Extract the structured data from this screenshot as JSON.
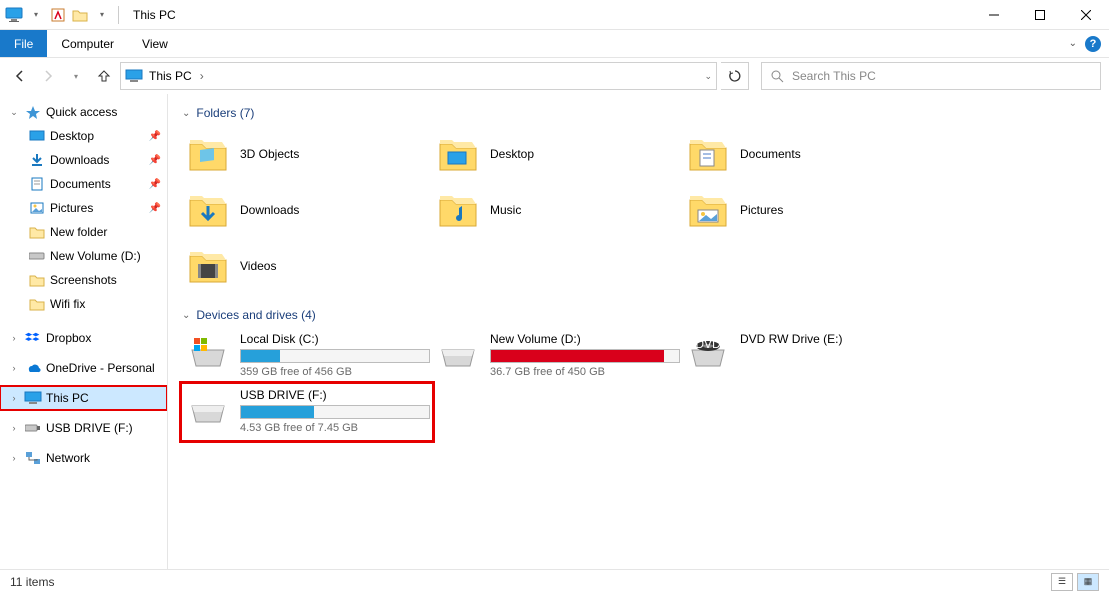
{
  "title": "This PC",
  "ribbon": {
    "file": "File",
    "computer": "Computer",
    "view": "View"
  },
  "breadcrumb": {
    "root": "This PC"
  },
  "search_placeholder": "Search This PC",
  "sidebar": {
    "quick_access": "Quick access",
    "qa_children": [
      {
        "label": "Desktop",
        "pin": true
      },
      {
        "label": "Downloads",
        "pin": true
      },
      {
        "label": "Documents",
        "pin": true
      },
      {
        "label": "Pictures",
        "pin": true
      },
      {
        "label": "New folder",
        "pin": false
      },
      {
        "label": "New Volume (D:)",
        "pin": false
      },
      {
        "label": "Screenshots",
        "pin": false
      },
      {
        "label": "Wifi fix",
        "pin": false
      }
    ],
    "dropbox": "Dropbox",
    "onedrive": "OneDrive - Personal",
    "this_pc": "This PC",
    "usb": "USB DRIVE (F:)",
    "network": "Network"
  },
  "groups": {
    "folders": {
      "title": "Folders (7)",
      "items": [
        "3D Objects",
        "Desktop",
        "Documents",
        "Downloads",
        "Music",
        "Pictures",
        "Videos"
      ]
    },
    "drives": {
      "title": "Devices and drives (4)",
      "items": [
        {
          "name": "Local Disk (C:)",
          "free": "359 GB free of 456 GB",
          "fill_pct": 21,
          "color": "#26a0da",
          "show_bar": true
        },
        {
          "name": "New Volume (D:)",
          "free": "36.7 GB free of 450 GB",
          "fill_pct": 92,
          "color": "#d9001b",
          "show_bar": true
        },
        {
          "name": "DVD RW Drive (E:)",
          "free": "",
          "fill_pct": 0,
          "color": "",
          "show_bar": false
        },
        {
          "name": "USB DRIVE (F:)",
          "free": "4.53 GB free of 7.45 GB",
          "fill_pct": 39,
          "color": "#26a0da",
          "show_bar": true,
          "highlight": true
        }
      ]
    }
  },
  "status": {
    "items": "11 items"
  }
}
